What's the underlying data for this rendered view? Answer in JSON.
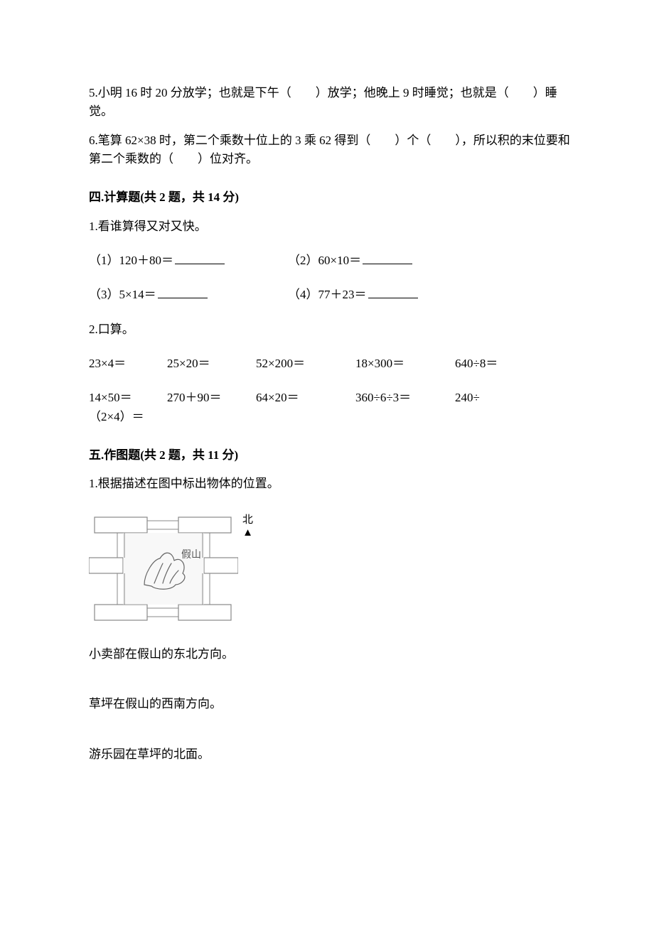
{
  "q5": {
    "text_a": "5.小明 16 时 20 分放学；也就是下午（  ）放学；他晚上 9 时睡觉；也就是（  ）睡觉。"
  },
  "q6": {
    "text": "6.笔算 62×38 时，第二个乘数十位上的 3 乘 62 得到（  ）个（  ），所以积的末位要和第二个乘数的（  ）位对齐。"
  },
  "section4": {
    "heading": "四.计算题(共 2 题，共 14 分)",
    "q1_title": "1.看谁算得又对又快。",
    "q1_items": {
      "a": "（1）120＋80＝",
      "b": "（2）60×10＝",
      "c": "（3）5×14＝",
      "d": "（4）77＋23＝"
    },
    "q2_title": "2.口算。",
    "q2_row1": {
      "c1": "23×4＝",
      "c2": "25×20＝",
      "c3": "52×200＝",
      "c4": "18×300＝",
      "c5": "640÷8＝"
    },
    "q2_row2": {
      "c1": "14×50＝",
      "c2": "270＋90＝",
      "c3": "64×20＝",
      "c4": "360÷6÷3＝",
      "c5_a": "240÷",
      "c5_b": "（2×4）＝"
    }
  },
  "section5": {
    "heading": "五.作图题(共 2 题，共 11 分)",
    "q1_title": "1.根据描述在图中标出物体的位置。",
    "diagram": {
      "north": "北",
      "arrow": "▲",
      "center_label": "假山"
    },
    "desc1": "小卖部在假山的东北方向。",
    "desc2": "草坪在假山的西南方向。",
    "desc3": "游乐园在草坪的北面。"
  }
}
